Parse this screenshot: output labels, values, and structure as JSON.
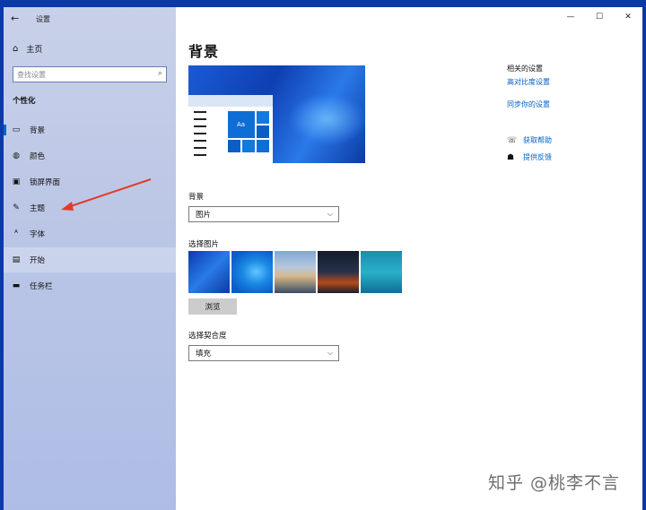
{
  "window": {
    "title": "设置",
    "controls": [
      "—",
      "☐",
      "✕"
    ]
  },
  "sidebar": {
    "back": "←",
    "home": {
      "icon": "home-icon",
      "glyph": "⌂",
      "label": "主页"
    },
    "search": {
      "placeholder": "查找设置",
      "icon": "search-icon",
      "glyph": "⌕"
    },
    "section": "个性化",
    "items": [
      {
        "label": "背景",
        "icon": "image-icon",
        "glyph": "▭"
      },
      {
        "label": "颜色",
        "icon": "palette-icon",
        "glyph": "◍"
      },
      {
        "label": "锁屏界面",
        "icon": "lockscreen-icon",
        "glyph": "▣"
      },
      {
        "label": "主题",
        "icon": "theme-icon",
        "glyph": "✎"
      },
      {
        "label": "字体",
        "icon": "font-icon",
        "glyph": "ᴬ"
      },
      {
        "label": "开始",
        "icon": "start-icon",
        "glyph": "▤"
      },
      {
        "label": "任务栏",
        "icon": "taskbar-icon",
        "glyph": "▬"
      }
    ],
    "selected": "背景"
  },
  "main": {
    "title": "背景",
    "preview": {
      "sample_text": "Aa"
    },
    "background_label": "背景",
    "background_value": "图片",
    "choose_picture_label": "选择图片",
    "browse_label": "浏览",
    "fit_label": "选择契合度",
    "fit_value": "填充",
    "chevron": "⌵"
  },
  "related": {
    "heading": "相关的设置",
    "links": [
      "高对比度设置",
      "同步你的设置"
    ],
    "help": [
      {
        "label": "获取帮助",
        "icon": "help-icon",
        "glyph": "☏"
      },
      {
        "label": "提供反馈",
        "icon": "feedback-icon",
        "glyph": "☗"
      }
    ]
  },
  "watermark": "知乎 @桃李不言",
  "colors": {
    "accent": "#0067c0",
    "link": "#0060c0",
    "annotation_arrow": "#e53a2a"
  }
}
